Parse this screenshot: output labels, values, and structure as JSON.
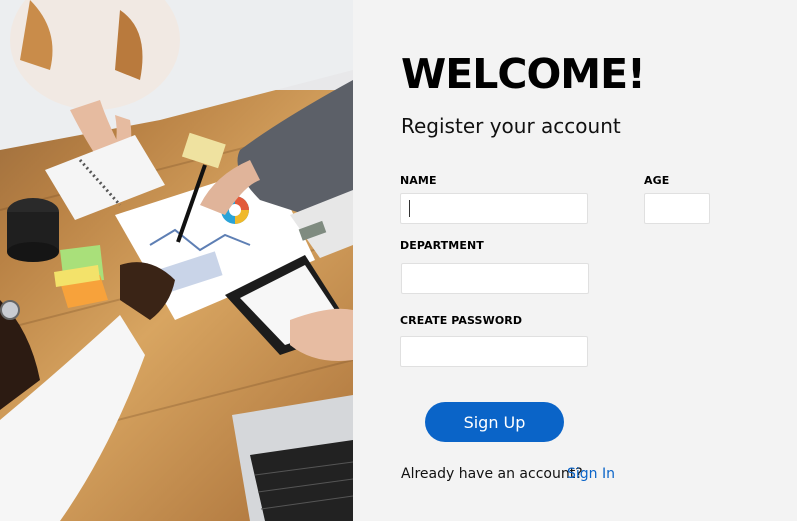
{
  "hero": {
    "image": "business-team-meeting-photo"
  },
  "form": {
    "title": "WELCOME!",
    "subtitle": "Register your account",
    "name_label": "NAME",
    "name_value": "",
    "age_label": "AGE",
    "age_value": "",
    "department_label": "DEPARTMENT",
    "department_value": "",
    "password_label": "CREATE PASSWORD",
    "password_value": "",
    "signup_label": "Sign Up",
    "already_text": "Already have an account?",
    "signin_label": "Sign In"
  },
  "colors": {
    "accent": "#0a64c8",
    "panel_bg": "#f3f3f3"
  }
}
